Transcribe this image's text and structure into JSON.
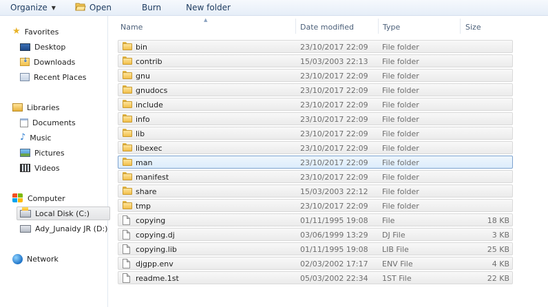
{
  "toolbar": {
    "organize_label": "Organize",
    "open_label": "Open",
    "burn_label": "Burn",
    "new_folder_label": "New folder"
  },
  "nav": {
    "favorites": {
      "label": "Favorites",
      "items": [
        {
          "label": "Desktop",
          "icon": "desktop-icon"
        },
        {
          "label": "Downloads",
          "icon": "downloads-icon"
        },
        {
          "label": "Recent Places",
          "icon": "recent-places-icon"
        }
      ]
    },
    "libraries": {
      "label": "Libraries",
      "items": [
        {
          "label": "Documents",
          "icon": "documents-icon"
        },
        {
          "label": "Music",
          "icon": "music-icon"
        },
        {
          "label": "Pictures",
          "icon": "pictures-icon"
        },
        {
          "label": "Videos",
          "icon": "videos-icon"
        }
      ]
    },
    "computer": {
      "label": "Computer",
      "items": [
        {
          "label": "Local Disk (C:)",
          "icon": "local-disk-icon",
          "selected": true
        },
        {
          "label": "Ady_Junaidy JR (D:)",
          "icon": "drive-icon"
        }
      ]
    },
    "network": {
      "label": "Network"
    }
  },
  "columns": {
    "name": "Name",
    "date_modified": "Date modified",
    "type": "Type",
    "size": "Size"
  },
  "files": [
    {
      "name": "bin",
      "date": "23/10/2017 22:09",
      "type": "File folder",
      "size": "",
      "kind": "folder"
    },
    {
      "name": "contrib",
      "date": "15/03/2003 22:13",
      "type": "File folder",
      "size": "",
      "kind": "folder"
    },
    {
      "name": "gnu",
      "date": "23/10/2017 22:09",
      "type": "File folder",
      "size": "",
      "kind": "folder"
    },
    {
      "name": "gnudocs",
      "date": "23/10/2017 22:09",
      "type": "File folder",
      "size": "",
      "kind": "folder"
    },
    {
      "name": "include",
      "date": "23/10/2017 22:09",
      "type": "File folder",
      "size": "",
      "kind": "folder"
    },
    {
      "name": "info",
      "date": "23/10/2017 22:09",
      "type": "File folder",
      "size": "",
      "kind": "folder"
    },
    {
      "name": "lib",
      "date": "23/10/2017 22:09",
      "type": "File folder",
      "size": "",
      "kind": "folder"
    },
    {
      "name": "libexec",
      "date": "23/10/2017 22:09",
      "type": "File folder",
      "size": "",
      "kind": "folder"
    },
    {
      "name": "man",
      "date": "23/10/2017 22:09",
      "type": "File folder",
      "size": "",
      "kind": "folder",
      "selected": true
    },
    {
      "name": "manifest",
      "date": "23/10/2017 22:09",
      "type": "File folder",
      "size": "",
      "kind": "folder"
    },
    {
      "name": "share",
      "date": "15/03/2003 22:12",
      "type": "File folder",
      "size": "",
      "kind": "folder"
    },
    {
      "name": "tmp",
      "date": "23/10/2017 22:09",
      "type": "File folder",
      "size": "",
      "kind": "folder"
    },
    {
      "name": "copying",
      "date": "01/11/1995 19:08",
      "type": "File",
      "size": "18 KB",
      "kind": "file"
    },
    {
      "name": "copying.dj",
      "date": "03/06/1999 13:29",
      "type": "DJ File",
      "size": "3 KB",
      "kind": "file"
    },
    {
      "name": "copying.lib",
      "date": "01/11/1995 19:08",
      "type": "LIB File",
      "size": "25 KB",
      "kind": "file"
    },
    {
      "name": "djgpp.env",
      "date": "02/03/2002 17:17",
      "type": "ENV File",
      "size": "4 KB",
      "kind": "file"
    },
    {
      "name": "readme.1st",
      "date": "05/03/2002 22:34",
      "type": "1ST File",
      "size": "22 KB",
      "kind": "file"
    }
  ]
}
